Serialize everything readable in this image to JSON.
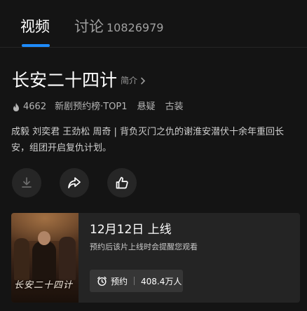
{
  "tabs": {
    "video_label": "视频",
    "discuss_label": "讨论",
    "discuss_count": "10826979"
  },
  "show": {
    "title": "长安二十四计",
    "intro_label": "简介",
    "heat": "4662",
    "rank": "新剧预约榜·TOP1",
    "genres": [
      "悬疑",
      "古装"
    ],
    "description": "成毅 刘奕君 王劲松 周奇 | 背负灭门之仇的谢淮安潜伏十余年重回长安，组团开启复仇计划。"
  },
  "actions": {
    "download_icon": "download-icon",
    "share_icon": "share-icon",
    "like_icon": "thumbs-up-icon"
  },
  "release_card": {
    "poster_logo": "长安二十四计",
    "release_text": "12月12日 上线",
    "hint": "预约后该片上线时会提醒您观看",
    "reserve_label": "预约",
    "reserve_count": "408.4万人"
  },
  "colors": {
    "background": "#141414",
    "accent": "#1e8cff",
    "card": "#242424"
  }
}
